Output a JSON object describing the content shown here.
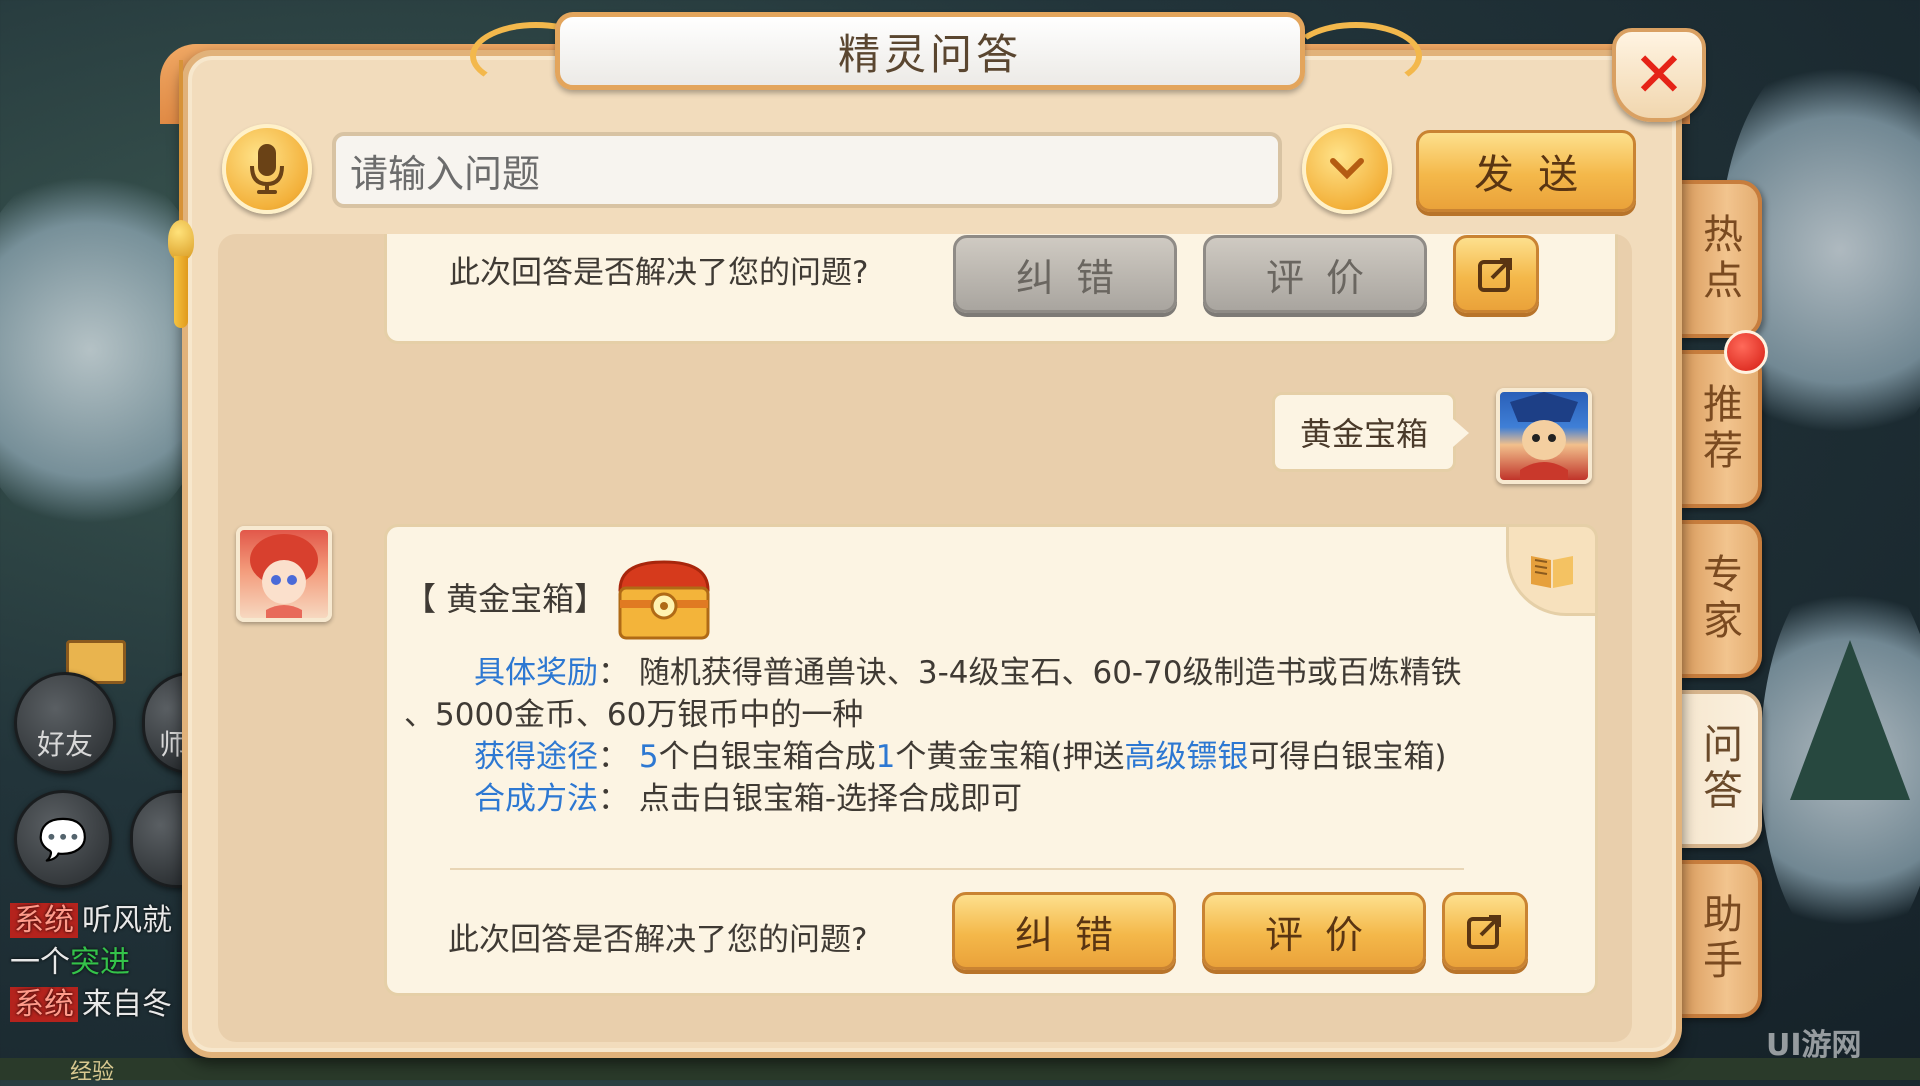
{
  "window": {
    "title": "精灵问答",
    "close_label": "✕"
  },
  "input": {
    "placeholder": "请输入问题",
    "send_label": "发送"
  },
  "side_tabs": [
    {
      "label": "热点"
    },
    {
      "label": "推荐",
      "has_notification": true
    },
    {
      "label": "专家"
    },
    {
      "label": "问答",
      "active": true
    },
    {
      "label": "助手"
    }
  ],
  "previous_answer": {
    "prompt": "此次回答是否解决了您的问题?",
    "correct_label": "纠错",
    "rate_label": "评价"
  },
  "user_message": {
    "text": "黄金宝箱"
  },
  "answer": {
    "title": "【 黄金宝箱】",
    "item_icon": "golden-chest-icon",
    "rewards_label": "具体奖励",
    "rewards_text": "随机获得普通兽诀、3-4级宝石、60-70级制造书或百炼精铁",
    "rewards_text_cont": "、5000金币、60万银币中的一种",
    "obtain_label": "获得途径",
    "obtain_num1": "5",
    "obtain_text1": "个白银宝箱合成",
    "obtain_num2": "1",
    "obtain_text2": "个黄金宝箱(押送",
    "obtain_link": "高级镖银",
    "obtain_text3": "可得白银宝箱)",
    "method_label": "合成方法",
    "method_text": "点击白银宝箱-选择合成即可",
    "feedback_prompt": "此次回答是否解决了您的问题?",
    "correct_label": "纠错",
    "rate_label": "评价"
  },
  "background_hud": {
    "friends_label": "好友",
    "mentor_label": "师",
    "chat_lines": [
      {
        "tag": "系统",
        "text": "听风就"
      },
      {
        "pre": "一个",
        "highlight": "突进"
      },
      {
        "tag": "系统",
        "text": "来自冬"
      }
    ],
    "exp_label": "经验"
  },
  "watermark": "UI游网",
  "colors": {
    "accent": "#f4b84a",
    "link": "#2d78d2",
    "close": "#e52317",
    "panel": "#f2dcbc"
  }
}
